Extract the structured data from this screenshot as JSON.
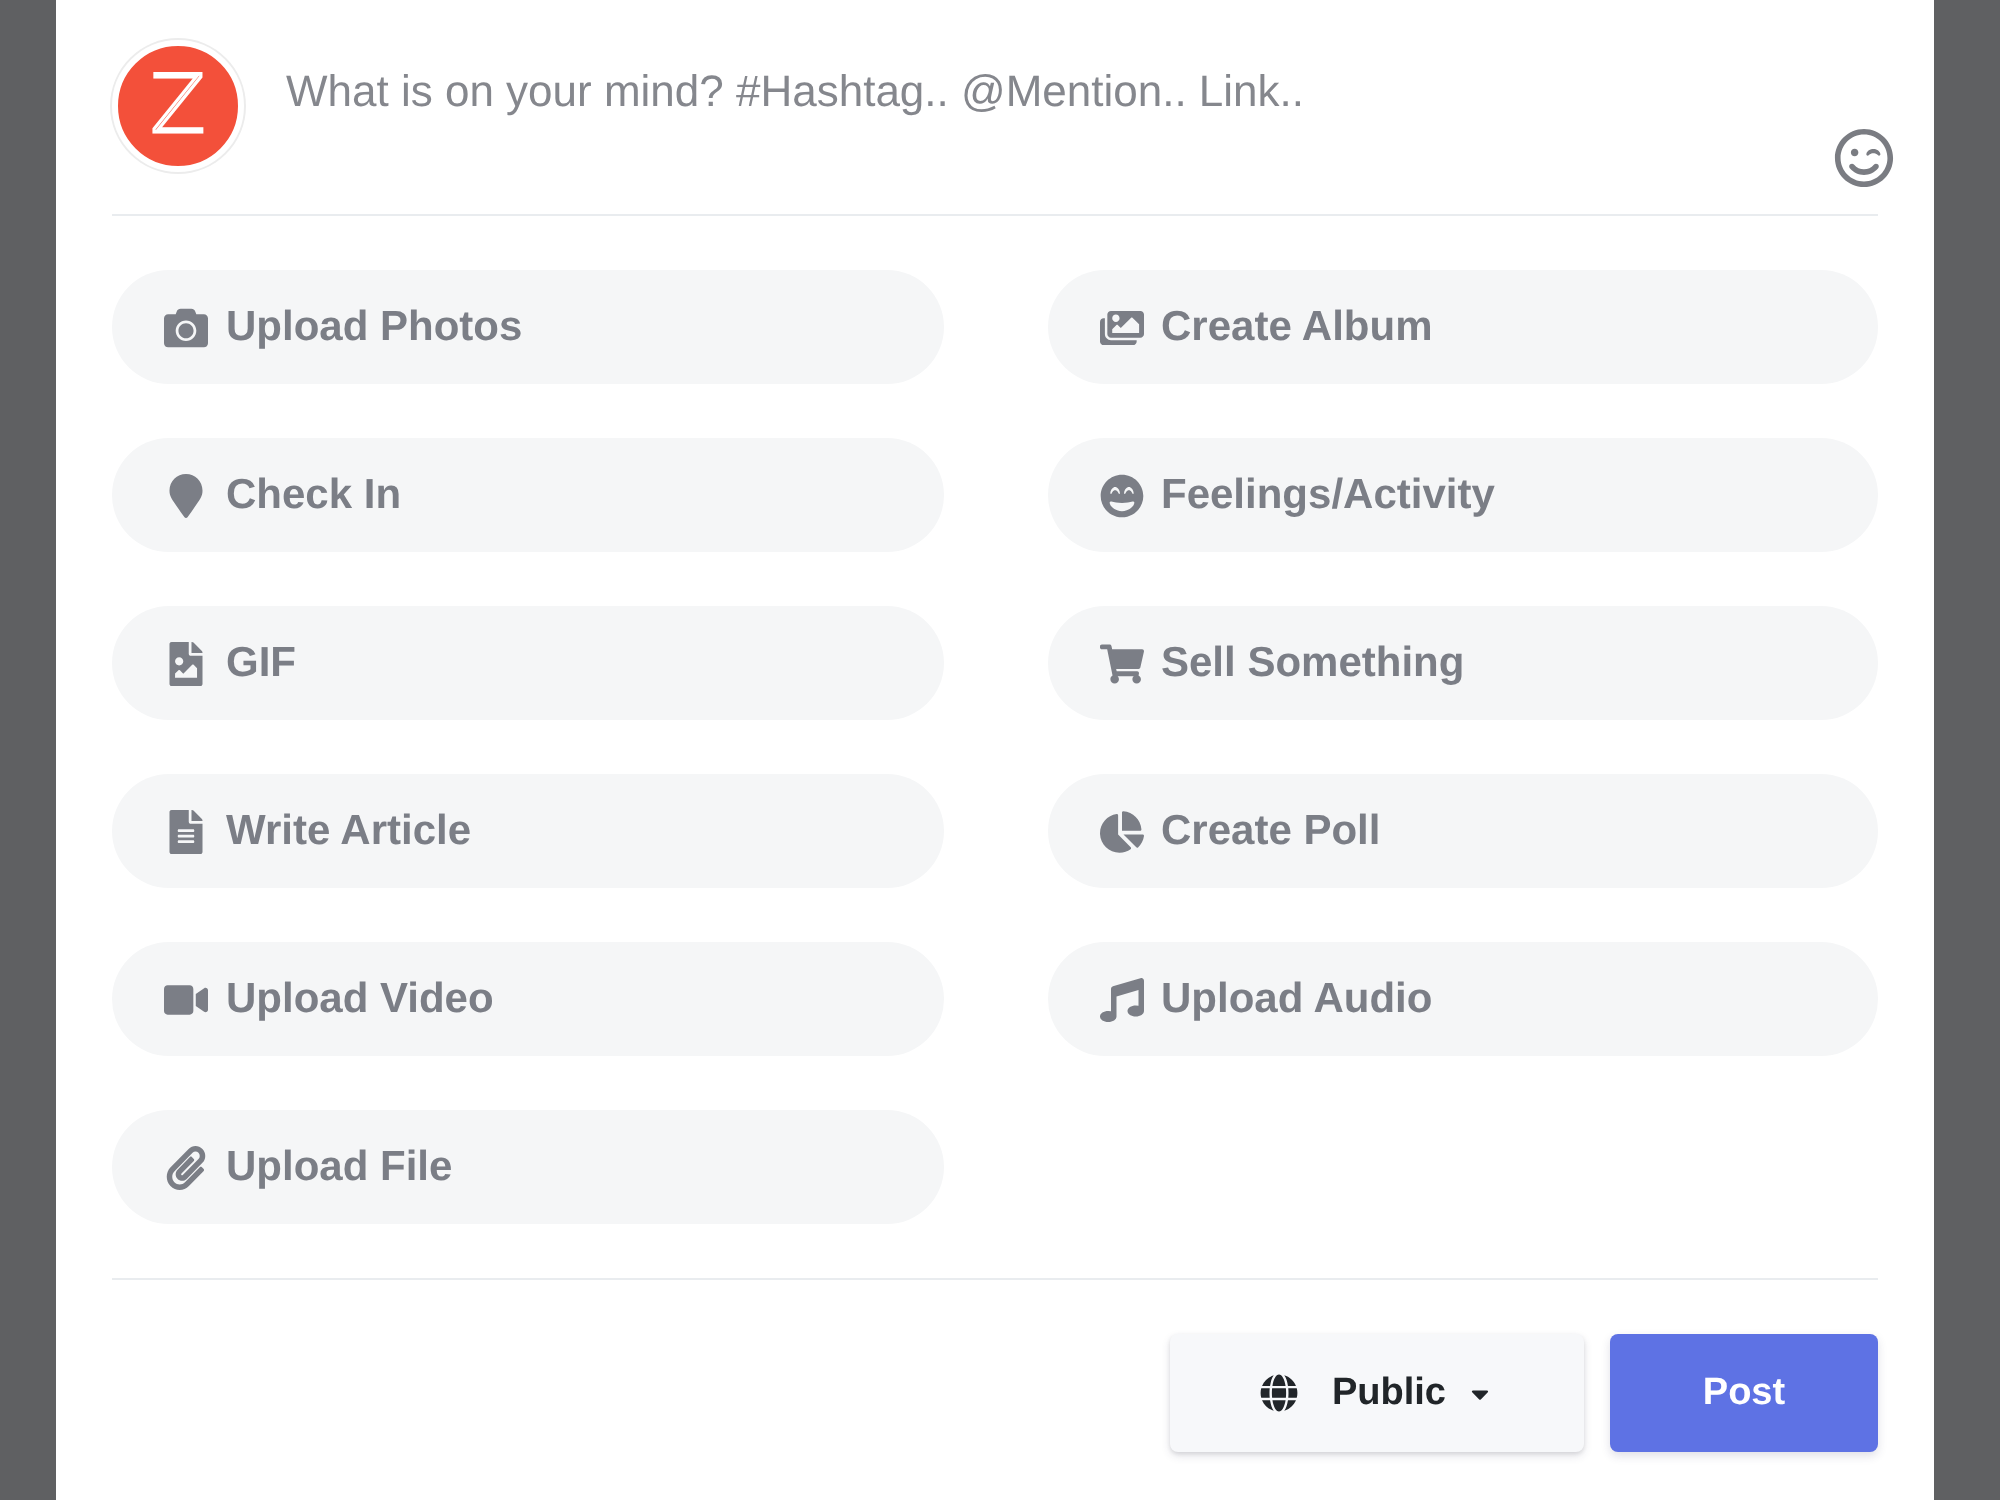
{
  "composer": {
    "avatar": {
      "letter": "Z"
    },
    "placeholder": "What is on your mind? #Hashtag.. @Mention.. Link.."
  },
  "actions": [
    {
      "kind": "photos",
      "label": "Upload Photos"
    },
    {
      "kind": "album",
      "label": "Create Album"
    },
    {
      "kind": "check_in",
      "label": "Check In"
    },
    {
      "kind": "feelings",
      "label": "Feelings/Activity"
    },
    {
      "kind": "gif",
      "label": "GIF"
    },
    {
      "kind": "sell",
      "label": "Sell Something"
    },
    {
      "kind": "article",
      "label": "Write Article"
    },
    {
      "kind": "poll",
      "label": "Create Poll"
    },
    {
      "kind": "video",
      "label": "Upload Video"
    },
    {
      "kind": "audio",
      "label": "Upload Audio"
    },
    {
      "kind": "file",
      "label": "Upload File"
    }
  ],
  "footer": {
    "privacy": {
      "label": "Public"
    },
    "submit": {
      "label": "Post"
    }
  }
}
